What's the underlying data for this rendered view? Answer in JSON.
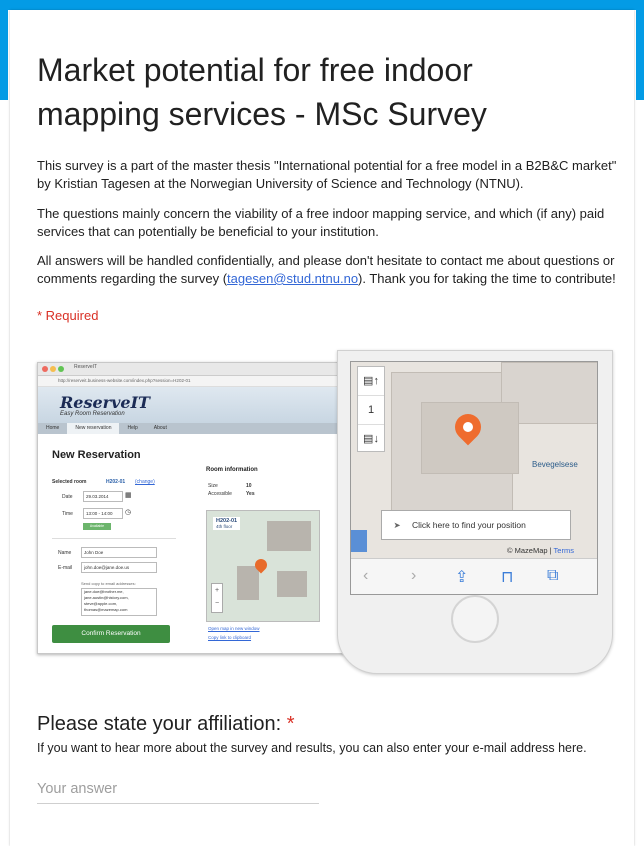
{
  "form": {
    "title": "Market potential for free indoor mapping services - MSc Survey",
    "description": {
      "p1": "This survey is a part of the master thesis \"International potential for a free model in a B2B&C market\" by Kristian Tagesen at the Norwegian University of Science and Technology (NTNU).",
      "p2": "The questions mainly concern the viability of a free indoor mapping service, and which (if any) paid services that can potentially be beneficial to your institution.",
      "p3_before": "All answers will be handled confidentially, and please don't hesitate to contact me about questions or comments regarding the survey (",
      "p3_email": "tagesen@stud.ntnu.no",
      "p3_after": "). Thank you for taking the time to contribute!"
    },
    "required_note": "* Required",
    "accent_color": "#039be5"
  },
  "illustration": {
    "browser": {
      "tab_title": "ReserveIT",
      "url": "http://reserveit.business-website.com/index.php?session=H202-01",
      "logo": "ReserveIT",
      "tagline": "Easy Room Reservation",
      "nav": [
        "Home",
        "New reservation",
        "Help",
        "About"
      ],
      "heading": "New Reservation",
      "selected_room_label": "Selected room",
      "selected_room": "H202-01",
      "change_link": "(change)",
      "date_label": "Date",
      "date_value": "29.03.2014",
      "time_label": "Time",
      "time_value": "13:00 - 14:00",
      "available": "Available",
      "name_label": "Name",
      "name_value": "John Doe",
      "email_label": "E-mail",
      "email_value": "john.doe@jane.doe.us",
      "copy_label": "Send copy to email addresses:",
      "copy_values": "jane.doe@brother.me,\njane.austin@history.com,\nsteve@apple.com,\nthomas@mazemap.com",
      "confirm_button": "Confirm Reservation",
      "room_info_title": "Room information",
      "size_label": "Size",
      "size_value": "10",
      "accessible_label": "Accessible",
      "accessible_value": "Yes",
      "map_room": "H202-01",
      "map_floor": "4th floor",
      "open_map_link": "Open map in new window",
      "copy_link": "Copy link to clipboard"
    },
    "phone": {
      "floor_number": "1",
      "map_label": "Bevegelsese",
      "find_position": "Click here to find your position",
      "attribution": "© MazeMap",
      "terms": "Terms"
    }
  },
  "question": {
    "title": "Please state your affiliation:",
    "required_star": "*",
    "help": "If you want to hear more about the survey and results, you can also enter your e-mail address here.",
    "placeholder": "Your answer"
  }
}
